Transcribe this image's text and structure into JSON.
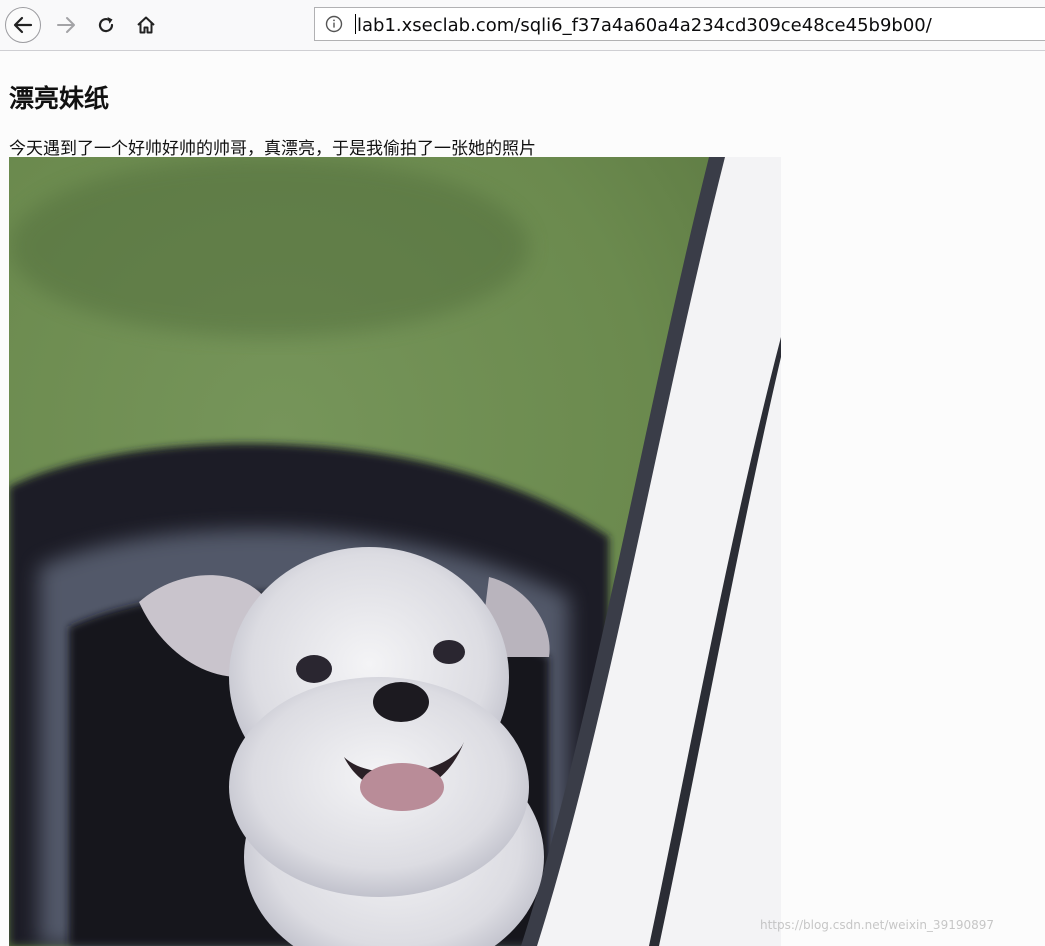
{
  "browser": {
    "url": "lab1.xseclab.com/sqli6_f37a4a60a4a234cd309ce48ce45b9b00/",
    "icons": {
      "back": "arrow-left-icon",
      "forward": "arrow-right-icon",
      "reload": "reload-icon",
      "home": "home-icon",
      "info": "info-icon"
    }
  },
  "page": {
    "title": "漂亮妹纸",
    "text": "今天遇到了一个好帅好帅的帅哥，真漂亮，于是我偷拍了一张她的照片"
  },
  "watermark": "https://blog.csdn.net/weixin_39190897",
  "colors": {
    "background": "#fcfcfc",
    "toolbar": "#f9f9fa",
    "photo_green": "#6b8a4e"
  }
}
